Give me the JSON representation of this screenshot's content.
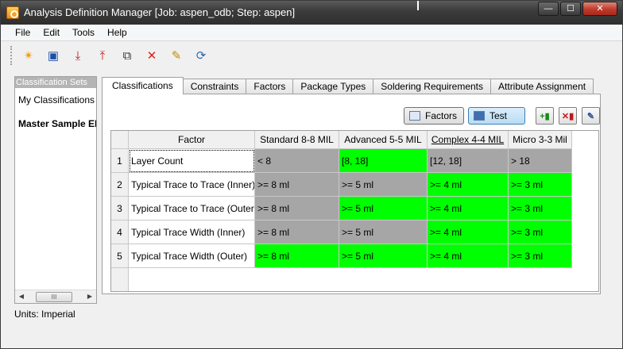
{
  "window": {
    "title": "Analysis Definition Manager [Job: aspen_odb; Step: aspen]",
    "controls": {
      "minimize": "—",
      "maximize": "☐",
      "close": "✕"
    }
  },
  "menu": [
    "File",
    "Edit",
    "Tools",
    "Help"
  ],
  "toolbar": {
    "buttons": [
      {
        "name": "new-icon",
        "glyph": "✴",
        "color": "#f29a00"
      },
      {
        "name": "save-icon",
        "glyph": "▣",
        "color": "#1d4fa8"
      },
      {
        "name": "export-icon",
        "glyph": "⤓",
        "color": "#c0181a"
      },
      {
        "name": "import-icon",
        "glyph": "⤒",
        "color": "#c0181a"
      },
      {
        "name": "copy-icon",
        "glyph": "⧉",
        "color": "#333333"
      },
      {
        "name": "delete-icon",
        "glyph": "✕",
        "color": "#d9231d"
      },
      {
        "name": "edit-icon",
        "glyph": "✎",
        "color": "#c08a00"
      },
      {
        "name": "refresh-icon",
        "glyph": "⟳",
        "color": "#2c6bb5"
      }
    ]
  },
  "sidebar": {
    "title": "Classification Sets",
    "items": [
      "My Classifications",
      "Master Sample ED"
    ],
    "scroll_thumb": "III"
  },
  "units": "Units: Imperial",
  "tabs": [
    "Classifications",
    "Constraints",
    "Factors",
    "Package Types",
    "Soldering Requirements",
    "Attribute Assignment"
  ],
  "active_tab": "Classifications",
  "panel": {
    "factors_button": "Factors",
    "test_button": "Test",
    "icon_buttons": [
      "add-column-icon",
      "delete-column-icon",
      "edit-column-icon"
    ]
  },
  "grid": {
    "columns": [
      "Factor",
      "Standard 8-8 MIL",
      "Advanced 5-5 MIL",
      "Complex 4-4 MIL",
      "Micro 3-3 Mil"
    ],
    "rows": [
      {
        "num": "1",
        "factor": "Layer Count",
        "cells": [
          "< 8",
          "[8, 18]",
          "[12, 18]",
          "> 18"
        ],
        "colors": [
          "#a6a6a6",
          "#00ff00",
          "#a6a6a6",
          "#a6a6a6"
        ]
      },
      {
        "num": "2",
        "factor": "Typical Trace to Trace (Inner)",
        "cells": [
          ">= 8  ml",
          ">= 5  ml",
          ">= 4  ml",
          ">= 3  ml"
        ],
        "colors": [
          "#a6a6a6",
          "#a6a6a6",
          "#00ff00",
          "#00ff00"
        ]
      },
      {
        "num": "3",
        "factor": "Typical Trace to Trace (Outer)",
        "cells": [
          ">= 8  ml",
          ">= 5  ml",
          ">= 4  ml",
          ">= 3  ml"
        ],
        "colors": [
          "#a6a6a6",
          "#00ff00",
          "#00ff00",
          "#00ff00"
        ]
      },
      {
        "num": "4",
        "factor": "Typical Trace Width (Inner)",
        "cells": [
          ">= 8  ml",
          ">= 5  ml",
          ">= 4  ml",
          ">= 3  ml"
        ],
        "colors": [
          "#a6a6a6",
          "#a6a6a6",
          "#00ff00",
          "#00ff00"
        ]
      },
      {
        "num": "5",
        "factor": "Typical Trace Width (Outer)",
        "cells": [
          ">= 8  ml",
          ">= 5  ml",
          ">= 4  ml",
          ">= 3  ml"
        ],
        "colors": [
          "#00ff00",
          "#00ff00",
          "#00ff00",
          "#00ff00"
        ]
      }
    ]
  }
}
